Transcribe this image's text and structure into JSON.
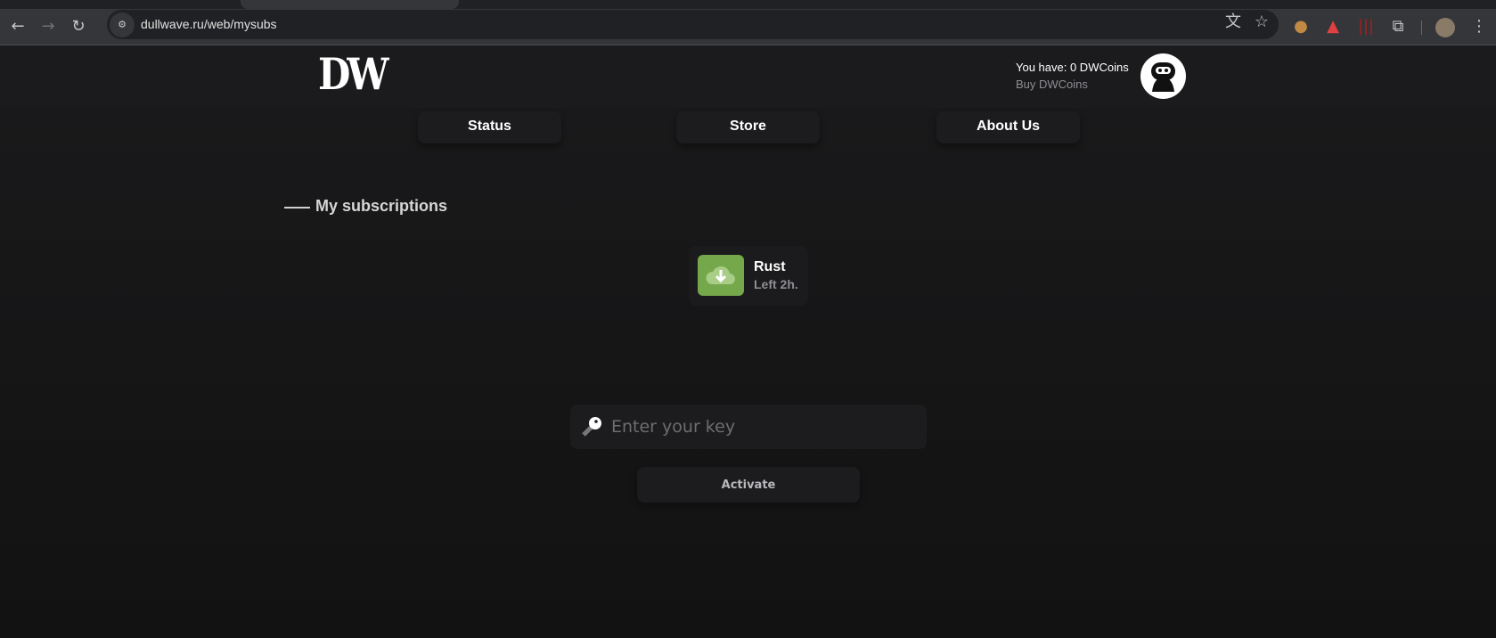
{
  "browser": {
    "url": "dullwave.ru/web/mysubs"
  },
  "header": {
    "logo_text": "DW",
    "coins_text": "You have: 0 DWCoins",
    "buy_link": "Buy DWCoins"
  },
  "nav": [
    {
      "label": "Status"
    },
    {
      "label": "Store"
    },
    {
      "label": "About Us"
    }
  ],
  "section": {
    "title": "My subscriptions"
  },
  "subscriptions": [
    {
      "name": "Rust",
      "remaining": "Left 2h.",
      "icon": "cloud-download-icon",
      "color": "#75a84a"
    }
  ],
  "activation": {
    "placeholder": "Enter your key",
    "button_label": "Activate"
  }
}
